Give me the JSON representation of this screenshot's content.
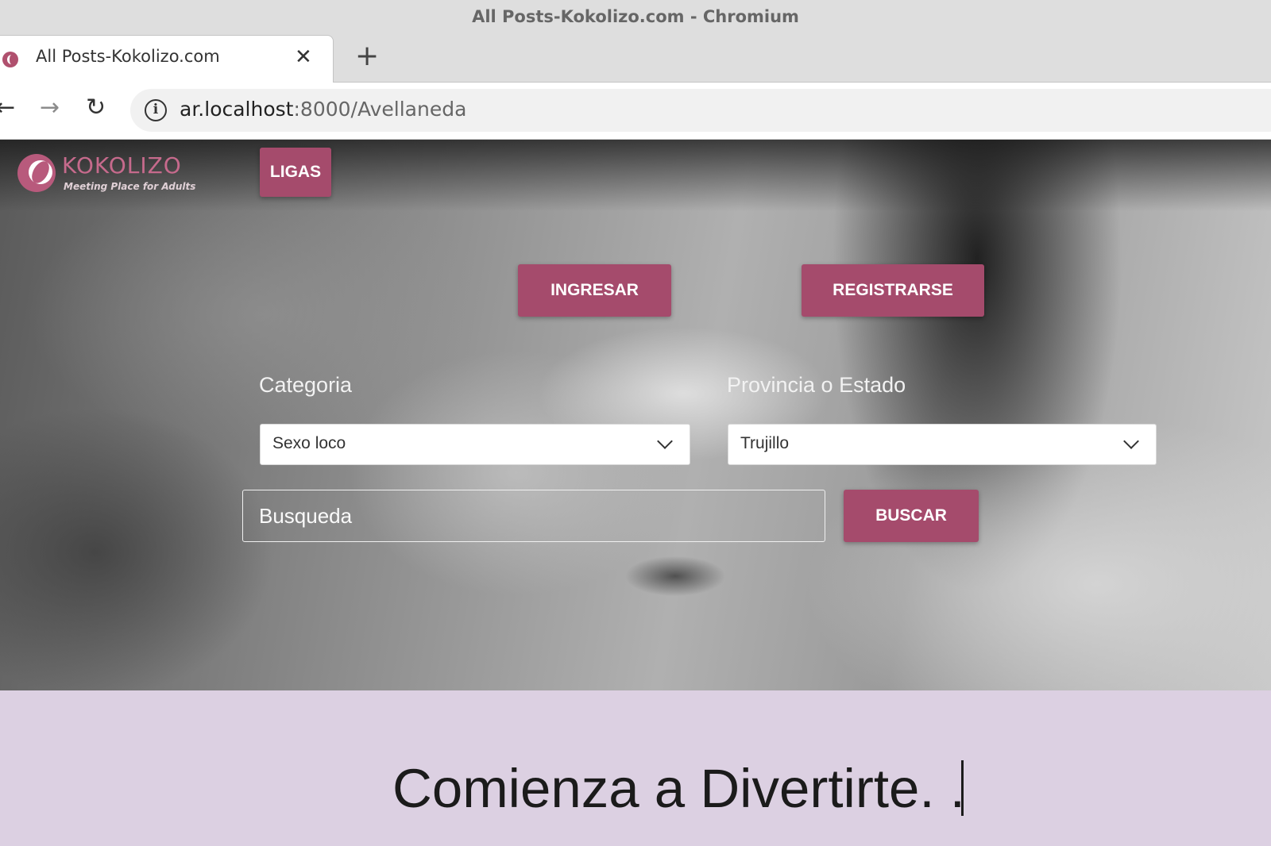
{
  "window": {
    "title": "All Posts-Kokolizo.com - Chromium"
  },
  "tab": {
    "title": "All Posts-Kokolizo.com",
    "close": "✕",
    "new_tab": "+"
  },
  "toolbar": {
    "back": "←",
    "forward": "→",
    "reload": "↻",
    "info": "i",
    "url_host": "ar.localhost",
    "url_rest": ":8000/Avellaneda"
  },
  "header": {
    "logo_name": "KOKOLIZO",
    "logo_tagline": "Meeting Place for Adults",
    "ligas_label": "LIGAS"
  },
  "auth": {
    "ingresar_label": "INGRESAR",
    "registrarse_label": "REGISTRARSE"
  },
  "filters": {
    "categoria_label": "Categoria",
    "categoria_value": "Sexo loco",
    "provincia_label": "Provincia o Estado",
    "provincia_value": "Trujillo"
  },
  "search": {
    "placeholder": "Busqueda",
    "button_label": "BUSCAR"
  },
  "footer": {
    "tagline": "Comienza a Divertirte. ."
  },
  "colors": {
    "accent": "#a54b6c",
    "band": "#dcd0e2"
  }
}
